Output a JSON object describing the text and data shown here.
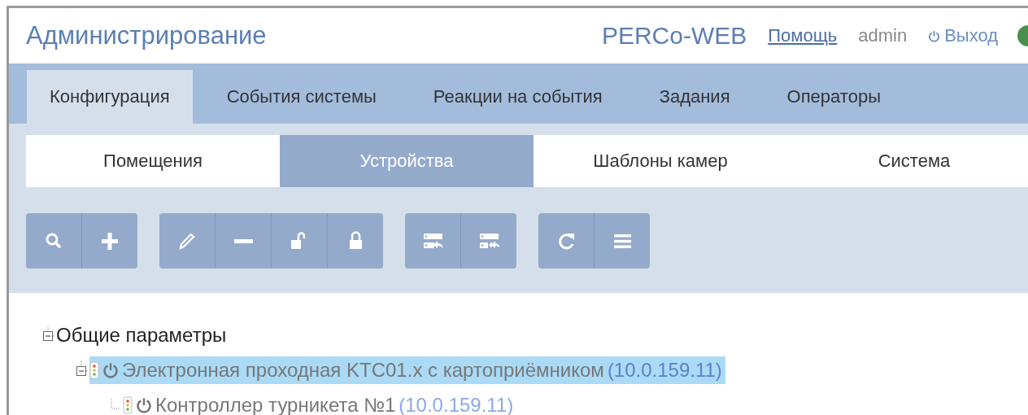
{
  "header": {
    "title": "Администрирование",
    "brand": "PERCo-WEB",
    "help_link": "Помощь",
    "user": "admin",
    "logout": "Выход"
  },
  "tabs": [
    {
      "label": "Конфигурация",
      "selected": true
    },
    {
      "label": "События системы",
      "selected": false
    },
    {
      "label": "Реакции на события",
      "selected": false
    },
    {
      "label": "Задания",
      "selected": false
    },
    {
      "label": "Операторы",
      "selected": false
    }
  ],
  "subtabs": [
    {
      "label": "Помещения",
      "selected": false
    },
    {
      "label": "Устройства",
      "selected": true
    },
    {
      "label": "Шаблоны камер",
      "selected": false
    },
    {
      "label": "Система",
      "selected": false
    }
  ],
  "tree": [
    {
      "kind": "group",
      "label": "Общие параметры",
      "expanded": true,
      "selected": false,
      "children": [
        {
          "kind": "device",
          "label": "Электронная проходная KTC01.x с картоприёмником",
          "address": "(10.0.159.11)",
          "expanded": true,
          "selected": true,
          "children": [
            {
              "kind": "device",
              "label": "Контроллер турникета №1",
              "address": "(10.0.159.11)",
              "selected": false
            }
          ]
        }
      ]
    }
  ]
}
